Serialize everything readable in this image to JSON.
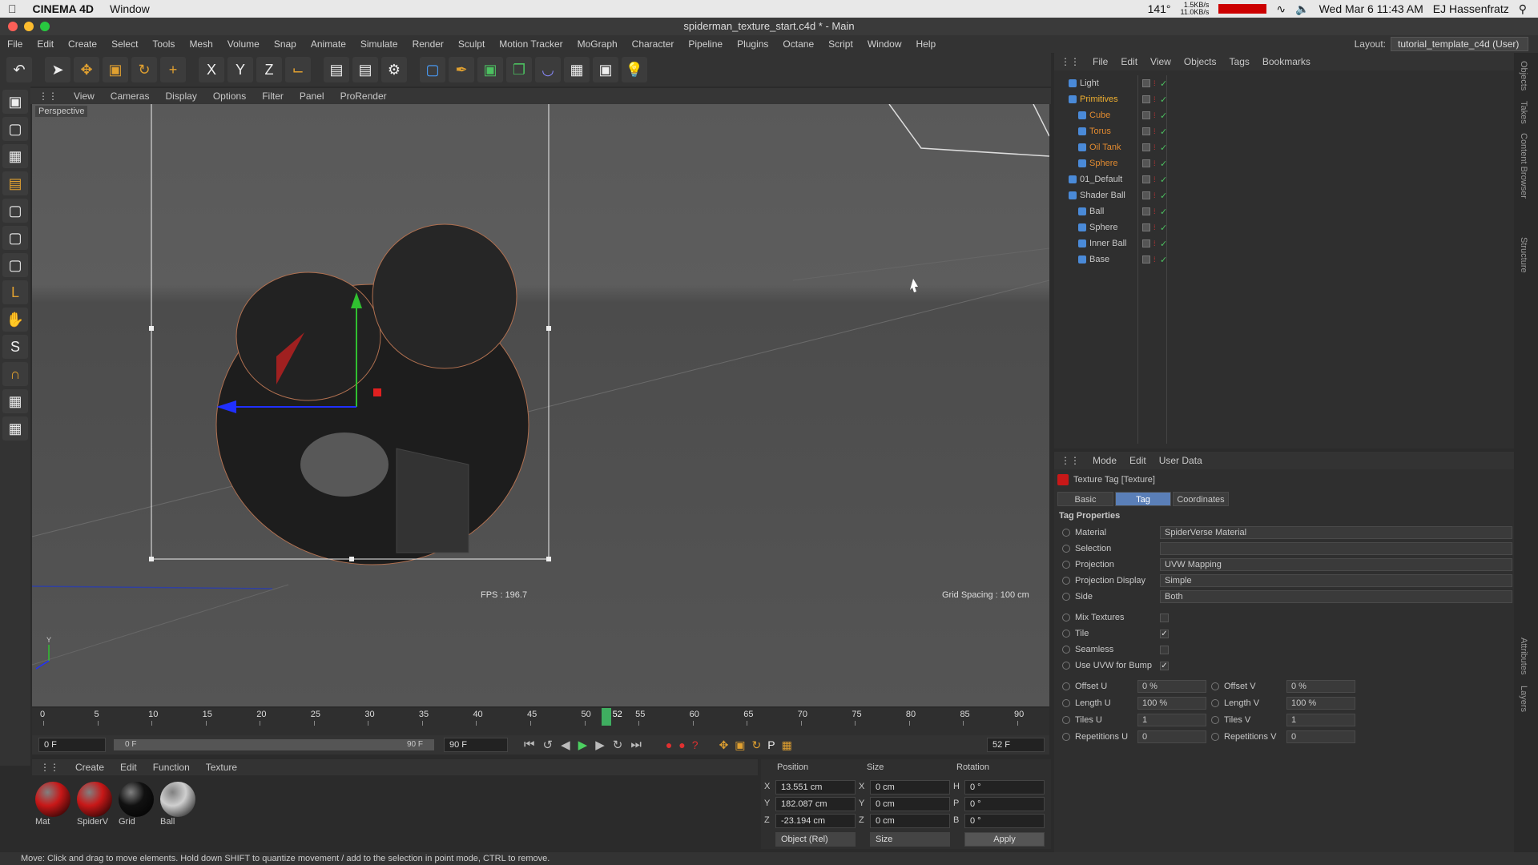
{
  "mac": {
    "app": "CINEMA 4D",
    "menu": "Window",
    "net_up": "1.5KB/s",
    "net_down": "11.0KB/s",
    "temp": "141°",
    "datetime": "Wed Mar 6  11:43 AM",
    "user": "EJ Hassenfratz"
  },
  "window_title": "spiderman_texture_start.c4d * - Main",
  "menu": [
    "File",
    "Edit",
    "Create",
    "Select",
    "Tools",
    "Mesh",
    "Volume",
    "Snap",
    "Animate",
    "Simulate",
    "Render",
    "Sculpt",
    "Motion Tracker",
    "MoGraph",
    "Character",
    "Pipeline",
    "Plugins",
    "Octane",
    "Script",
    "Window",
    "Help"
  ],
  "layout": {
    "label": "Layout:",
    "value": "tutorial_template_c4d (User)"
  },
  "viewport": {
    "menu": [
      "View",
      "Cameras",
      "Display",
      "Options",
      "Filter",
      "Panel",
      "ProRender"
    ],
    "label": "Perspective",
    "fps": "FPS : 196.7",
    "grid_spacing": "Grid Spacing : 100 cm"
  },
  "timeline": {
    "ticks": [
      "0",
      "5",
      "10",
      "15",
      "20",
      "25",
      "30",
      "35",
      "40",
      "45",
      "50",
      "55",
      "60",
      "65",
      "70",
      "75",
      "80",
      "85",
      "90"
    ],
    "current": "52",
    "start_field": "0 F",
    "range_left": "0 F",
    "range_right": "90 F",
    "end_field": "90 F",
    "frame_field": "52 F"
  },
  "materials": {
    "menu": [
      "Create",
      "Edit",
      "Function",
      "Texture"
    ],
    "items": [
      {
        "name": "Mat",
        "color": "#c81818"
      },
      {
        "name": "SpiderV",
        "color": "#c81818"
      },
      {
        "name": "Grid",
        "color": "#111111"
      },
      {
        "name": "Ball",
        "color": "#cfcfcf"
      }
    ]
  },
  "coords": {
    "headers": [
      "Position",
      "Size",
      "Rotation"
    ],
    "rows": [
      {
        "axis": "X",
        "pos": "13.551 cm",
        "saxis": "X",
        "size": "0 cm",
        "raxis": "H",
        "rot": "0 °"
      },
      {
        "axis": "Y",
        "pos": "182.087 cm",
        "saxis": "Y",
        "size": "0 cm",
        "raxis": "P",
        "rot": "0 °"
      },
      {
        "axis": "Z",
        "pos": "-23.194 cm",
        "saxis": "Z",
        "size": "0 cm",
        "raxis": "B",
        "rot": "0 °"
      }
    ],
    "mode": "Object (Rel)",
    "size_mode": "Size",
    "apply": "Apply"
  },
  "objects": {
    "menu": [
      "File",
      "Edit",
      "View",
      "Objects",
      "Tags",
      "Bookmarks"
    ],
    "items": [
      {
        "name": "Light",
        "indent": 0,
        "color": "#c8c8c8"
      },
      {
        "name": "Primitives",
        "indent": 0,
        "color": "#f0b030"
      },
      {
        "name": "Cube",
        "indent": 1,
        "color": "#e08a30"
      },
      {
        "name": "Torus",
        "indent": 1,
        "color": "#e08a30"
      },
      {
        "name": "Oil Tank",
        "indent": 1,
        "color": "#e08a30"
      },
      {
        "name": "Sphere",
        "indent": 1,
        "color": "#e08a30"
      },
      {
        "name": "01_Default",
        "indent": 0,
        "color": "#c8c8c8"
      },
      {
        "name": "Shader Ball",
        "indent": 0,
        "color": "#c8c8c8"
      },
      {
        "name": "Ball",
        "indent": 1,
        "color": "#c8c8c8"
      },
      {
        "name": "Sphere",
        "indent": 1,
        "color": "#c8c8c8"
      },
      {
        "name": "Inner Ball",
        "indent": 1,
        "color": "#c8c8c8"
      },
      {
        "name": "Base",
        "indent": 1,
        "color": "#c8c8c8"
      }
    ]
  },
  "attributes": {
    "menu": [
      "Mode",
      "Edit",
      "User Data"
    ],
    "title": "Texture Tag [Texture]",
    "tabs": [
      "Basic",
      "Tag",
      "Coordinates"
    ],
    "section": "Tag Properties",
    "props": [
      {
        "label": "Material",
        "value": "SpiderVerse Material"
      },
      {
        "label": "Selection",
        "value": ""
      },
      {
        "label": "Projection",
        "value": "UVW Mapping"
      },
      {
        "label": "Projection Display",
        "value": "Simple"
      },
      {
        "label": "Side",
        "value": "Both"
      }
    ],
    "checks": [
      {
        "label": "Mix Textures",
        "checked": false
      },
      {
        "label": "Tile",
        "checked": true
      },
      {
        "label": "Seamless",
        "checked": false
      },
      {
        "label": "Use UVW for Bump",
        "checked": true
      }
    ],
    "offsets": [
      {
        "l1": "Offset U",
        "v1": "0 %",
        "l2": "Offset V",
        "v2": "0 %"
      },
      {
        "l1": "Length U",
        "v1": "100 %",
        "l2": "Length V",
        "v2": "100 %"
      },
      {
        "l1": "Tiles U",
        "v1": "1",
        "l2": "Tiles V",
        "v2": "1"
      },
      {
        "l1": "Repetitions U",
        "v1": "0",
        "l2": "Repetitions V",
        "v2": "0"
      }
    ]
  },
  "side_tabs": [
    "Objects",
    "Takes",
    "Content Browser",
    "Structure",
    "Attributes",
    "Layers"
  ],
  "status": "Move: Click and drag to move elements. Hold down SHIFT to quantize movement / add to the selection in point mode, CTRL to remove."
}
